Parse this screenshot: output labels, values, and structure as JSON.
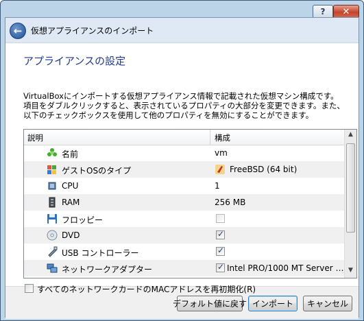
{
  "window": {
    "help_label": "?",
    "close_label": "✕"
  },
  "header": {
    "title": "仮想アプライアンスのインポート"
  },
  "section": {
    "title": "アプライアンスの設定"
  },
  "description": "VirtualBoxにインポートする仮想アプライアンス情報で記載された仮想マシン構成です。項目をダブルクリックすると、表示されているプロパティの大部分を変更できます。また、以下のチェックボックスを使用して他のプロパティを無効にすることができます。",
  "table": {
    "headers": {
      "description": "説明",
      "config": "構成"
    },
    "rows": [
      {
        "icon": "name-star-icon",
        "label": "名前",
        "value": "vm"
      },
      {
        "icon": "os-type-icon",
        "label": "ゲストOSのタイプ",
        "value": "FreeBSD (64 bit)",
        "value_icon": "freebsd-icon"
      },
      {
        "icon": "cpu-icon",
        "label": "CPU",
        "value": "1"
      },
      {
        "icon": "ram-icon",
        "label": "RAM",
        "value": "256 MB"
      },
      {
        "icon": "floppy-icon",
        "label": "フロッピー",
        "checked": false
      },
      {
        "icon": "dvd-icon",
        "label": "DVD",
        "checked": true
      },
      {
        "icon": "usb-icon",
        "label": "USB コントローラー",
        "checked": true
      },
      {
        "icon": "network-icon",
        "label": "ネットワークアダプター",
        "checked": true,
        "value": "Intel PRO/1000 MT Server …"
      }
    ]
  },
  "reinit_mac": {
    "label": "すべてのネットワークカードのMACアドレスを再初期化(R)",
    "checked": false
  },
  "buttons": {
    "restore_defaults": "デフォルト値に戻す",
    "import": "インポート",
    "cancel": "キャンセル"
  }
}
